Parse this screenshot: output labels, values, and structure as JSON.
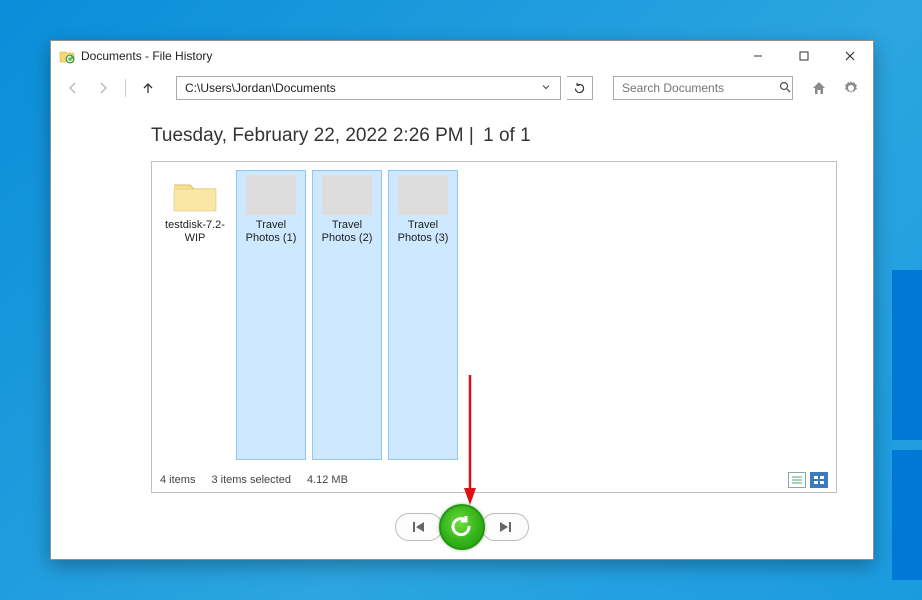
{
  "window": {
    "title": "Documents - File History"
  },
  "nav": {
    "address": "C:\\Users\\Jordan\\Documents",
    "search_placeholder": "Search Documents"
  },
  "header": {
    "timestamp": "Tuesday, February 22, 2022 2:26 PM",
    "separator": "  |  ",
    "page": "1 of 1"
  },
  "items": [
    {
      "label": "testdisk-7.2-WIP",
      "type": "folder",
      "selected": false
    },
    {
      "label": "Travel Photos (1)",
      "type": "photo",
      "thumbclass": "photo1",
      "selected": true
    },
    {
      "label": "Travel Photos (2)",
      "type": "photo",
      "thumbclass": "photo2",
      "selected": true
    },
    {
      "label": "Travel Photos (3)",
      "type": "photo",
      "thumbclass": "photo3",
      "selected": true
    }
  ],
  "status": {
    "count": "4 items",
    "selection": "3 items selected",
    "size": "4.12 MB"
  },
  "icons": {
    "back": "back-arrow-icon",
    "forward": "forward-arrow-icon",
    "up": "up-arrow-icon",
    "refresh": "refresh-icon",
    "search": "search-icon",
    "home": "home-icon",
    "settings": "gear-icon",
    "dropdown": "chevron-down-icon",
    "skip_prev": "skip-previous-icon",
    "skip_next": "skip-next-icon",
    "restore": "restore-icon",
    "details": "details-view-icon",
    "thumbnails": "thumbnails-view-icon"
  }
}
